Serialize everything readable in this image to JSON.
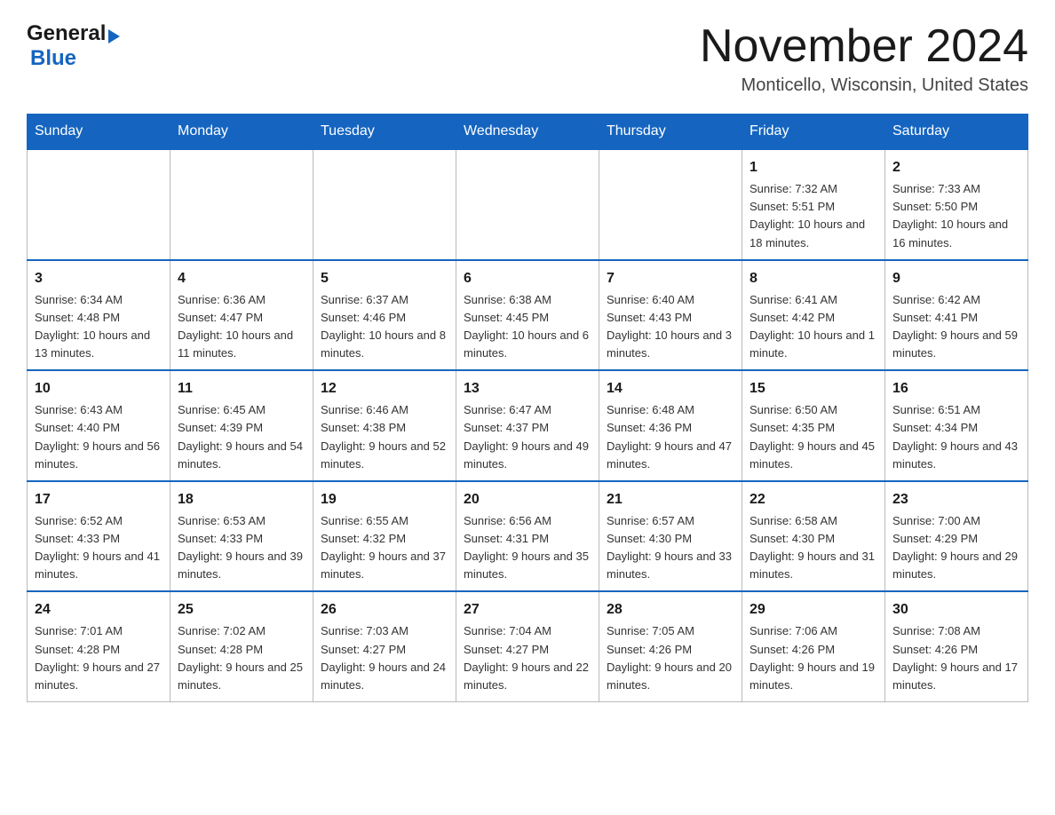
{
  "header": {
    "logo_general": "General",
    "logo_triangle": "▶",
    "logo_blue": "Blue",
    "month_year": "November 2024",
    "location": "Monticello, Wisconsin, United States"
  },
  "weekdays": [
    "Sunday",
    "Monday",
    "Tuesday",
    "Wednesday",
    "Thursday",
    "Friday",
    "Saturday"
  ],
  "weeks": [
    [
      {
        "day": "",
        "info": ""
      },
      {
        "day": "",
        "info": ""
      },
      {
        "day": "",
        "info": ""
      },
      {
        "day": "",
        "info": ""
      },
      {
        "day": "",
        "info": ""
      },
      {
        "day": "1",
        "info": "Sunrise: 7:32 AM\nSunset: 5:51 PM\nDaylight: 10 hours\nand 18 minutes."
      },
      {
        "day": "2",
        "info": "Sunrise: 7:33 AM\nSunset: 5:50 PM\nDaylight: 10 hours\nand 16 minutes."
      }
    ],
    [
      {
        "day": "3",
        "info": "Sunrise: 6:34 AM\nSunset: 4:48 PM\nDaylight: 10 hours\nand 13 minutes."
      },
      {
        "day": "4",
        "info": "Sunrise: 6:36 AM\nSunset: 4:47 PM\nDaylight: 10 hours\nand 11 minutes."
      },
      {
        "day": "5",
        "info": "Sunrise: 6:37 AM\nSunset: 4:46 PM\nDaylight: 10 hours\nand 8 minutes."
      },
      {
        "day": "6",
        "info": "Sunrise: 6:38 AM\nSunset: 4:45 PM\nDaylight: 10 hours\nand 6 minutes."
      },
      {
        "day": "7",
        "info": "Sunrise: 6:40 AM\nSunset: 4:43 PM\nDaylight: 10 hours\nand 3 minutes."
      },
      {
        "day": "8",
        "info": "Sunrise: 6:41 AM\nSunset: 4:42 PM\nDaylight: 10 hours\nand 1 minute."
      },
      {
        "day": "9",
        "info": "Sunrise: 6:42 AM\nSunset: 4:41 PM\nDaylight: 9 hours\nand 59 minutes."
      }
    ],
    [
      {
        "day": "10",
        "info": "Sunrise: 6:43 AM\nSunset: 4:40 PM\nDaylight: 9 hours\nand 56 minutes."
      },
      {
        "day": "11",
        "info": "Sunrise: 6:45 AM\nSunset: 4:39 PM\nDaylight: 9 hours\nand 54 minutes."
      },
      {
        "day": "12",
        "info": "Sunrise: 6:46 AM\nSunset: 4:38 PM\nDaylight: 9 hours\nand 52 minutes."
      },
      {
        "day": "13",
        "info": "Sunrise: 6:47 AM\nSunset: 4:37 PM\nDaylight: 9 hours\nand 49 minutes."
      },
      {
        "day": "14",
        "info": "Sunrise: 6:48 AM\nSunset: 4:36 PM\nDaylight: 9 hours\nand 47 minutes."
      },
      {
        "day": "15",
        "info": "Sunrise: 6:50 AM\nSunset: 4:35 PM\nDaylight: 9 hours\nand 45 minutes."
      },
      {
        "day": "16",
        "info": "Sunrise: 6:51 AM\nSunset: 4:34 PM\nDaylight: 9 hours\nand 43 minutes."
      }
    ],
    [
      {
        "day": "17",
        "info": "Sunrise: 6:52 AM\nSunset: 4:33 PM\nDaylight: 9 hours\nand 41 minutes."
      },
      {
        "day": "18",
        "info": "Sunrise: 6:53 AM\nSunset: 4:33 PM\nDaylight: 9 hours\nand 39 minutes."
      },
      {
        "day": "19",
        "info": "Sunrise: 6:55 AM\nSunset: 4:32 PM\nDaylight: 9 hours\nand 37 minutes."
      },
      {
        "day": "20",
        "info": "Sunrise: 6:56 AM\nSunset: 4:31 PM\nDaylight: 9 hours\nand 35 minutes."
      },
      {
        "day": "21",
        "info": "Sunrise: 6:57 AM\nSunset: 4:30 PM\nDaylight: 9 hours\nand 33 minutes."
      },
      {
        "day": "22",
        "info": "Sunrise: 6:58 AM\nSunset: 4:30 PM\nDaylight: 9 hours\nand 31 minutes."
      },
      {
        "day": "23",
        "info": "Sunrise: 7:00 AM\nSunset: 4:29 PM\nDaylight: 9 hours\nand 29 minutes."
      }
    ],
    [
      {
        "day": "24",
        "info": "Sunrise: 7:01 AM\nSunset: 4:28 PM\nDaylight: 9 hours\nand 27 minutes."
      },
      {
        "day": "25",
        "info": "Sunrise: 7:02 AM\nSunset: 4:28 PM\nDaylight: 9 hours\nand 25 minutes."
      },
      {
        "day": "26",
        "info": "Sunrise: 7:03 AM\nSunset: 4:27 PM\nDaylight: 9 hours\nand 24 minutes."
      },
      {
        "day": "27",
        "info": "Sunrise: 7:04 AM\nSunset: 4:27 PM\nDaylight: 9 hours\nand 22 minutes."
      },
      {
        "day": "28",
        "info": "Sunrise: 7:05 AM\nSunset: 4:26 PM\nDaylight: 9 hours\nand 20 minutes."
      },
      {
        "day": "29",
        "info": "Sunrise: 7:06 AM\nSunset: 4:26 PM\nDaylight: 9 hours\nand 19 minutes."
      },
      {
        "day": "30",
        "info": "Sunrise: 7:08 AM\nSunset: 4:26 PM\nDaylight: 9 hours\nand 17 minutes."
      }
    ]
  ]
}
